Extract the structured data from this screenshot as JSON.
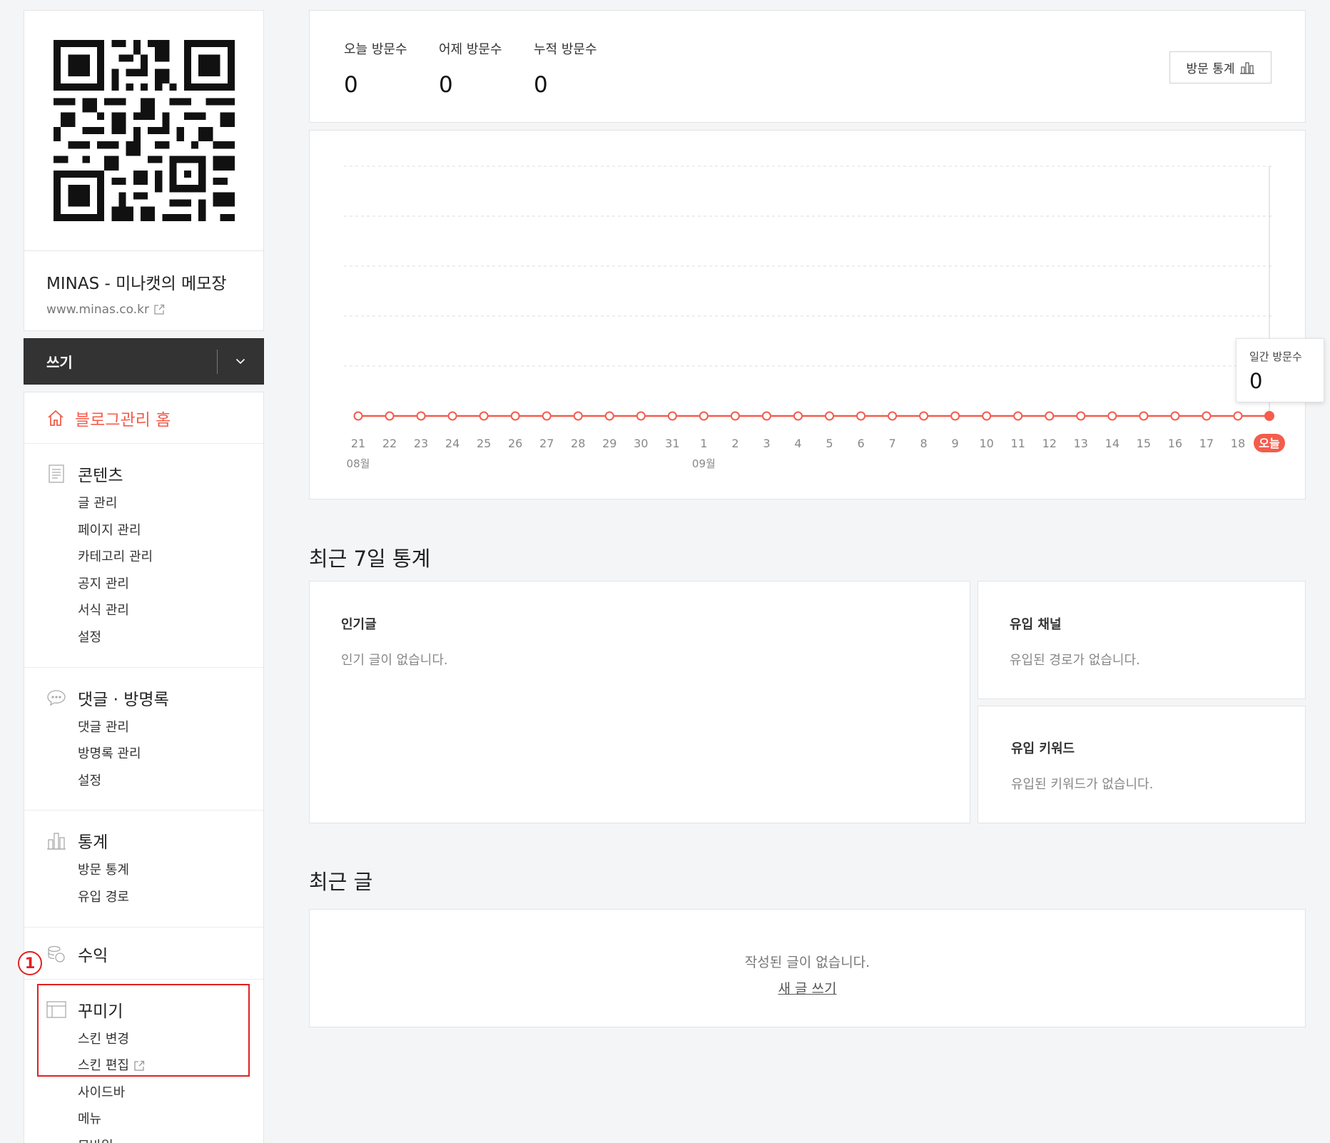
{
  "sidebar": {
    "blog_title": "MINAS - 미나캣의 메모장",
    "blog_url": "www.minas.co.kr",
    "write_label": "쓰기",
    "home_label": "블로그관리 홈",
    "sections": {
      "content": {
        "title": "콘텐츠",
        "items": [
          "글 관리",
          "페이지 관리",
          "카테고리 관리",
          "공지 관리",
          "서식 관리",
          "설정"
        ]
      },
      "comments": {
        "title": "댓글 · 방명록",
        "items": [
          "댓글 관리",
          "방명록 관리",
          "설정"
        ]
      },
      "stats": {
        "title": "통계",
        "items": [
          "방문 통계",
          "유입 경로"
        ]
      },
      "revenue": {
        "title": "수익"
      },
      "decorate": {
        "title": "꾸미기",
        "items": [
          "스킨 변경",
          "스킨 편집",
          "사이드바",
          "메뉴",
          "모바일"
        ]
      }
    },
    "annotation_badge": "1"
  },
  "visits": {
    "today_label": "오늘 방문수",
    "today_value": "0",
    "yesterday_label": "어제 방문수",
    "yesterday_value": "0",
    "total_label": "누적 방문수",
    "total_value": "0",
    "stats_button": "방문 통계"
  },
  "tooltip": {
    "label": "일간 방문수",
    "value": "0"
  },
  "chart_data": {
    "type": "line",
    "x": [
      "21",
      "22",
      "23",
      "24",
      "25",
      "26",
      "27",
      "28",
      "29",
      "30",
      "31",
      "1",
      "2",
      "3",
      "4",
      "5",
      "6",
      "7",
      "8",
      "9",
      "10",
      "11",
      "12",
      "13",
      "14",
      "15",
      "16",
      "17",
      "18",
      "오늘"
    ],
    "month_labels": [
      {
        "index": 0,
        "label": "08월"
      },
      {
        "index": 11,
        "label": "09월"
      }
    ],
    "series": [
      {
        "values": [
          0,
          0,
          0,
          0,
          0,
          0,
          0,
          0,
          0,
          0,
          0,
          0,
          0,
          0,
          0,
          0,
          0,
          0,
          0,
          0,
          0,
          0,
          0,
          0,
          0,
          0,
          0,
          0,
          0,
          0
        ]
      }
    ],
    "grid": true,
    "color": "#f45c4c"
  },
  "recent7": {
    "title": "최근 7일 통계",
    "popular": {
      "title": "인기글",
      "empty": "인기 글이 없습니다."
    },
    "channel": {
      "title": "유입 채널",
      "empty": "유입된 경로가 없습니다."
    },
    "keyword": {
      "title": "유입 키워드",
      "empty": "유입된 키워드가 없습니다."
    }
  },
  "recent_posts": {
    "title": "최근 글",
    "empty": "작성된 글이 없습니다.",
    "new_post_link": "새 글 쓰기"
  }
}
